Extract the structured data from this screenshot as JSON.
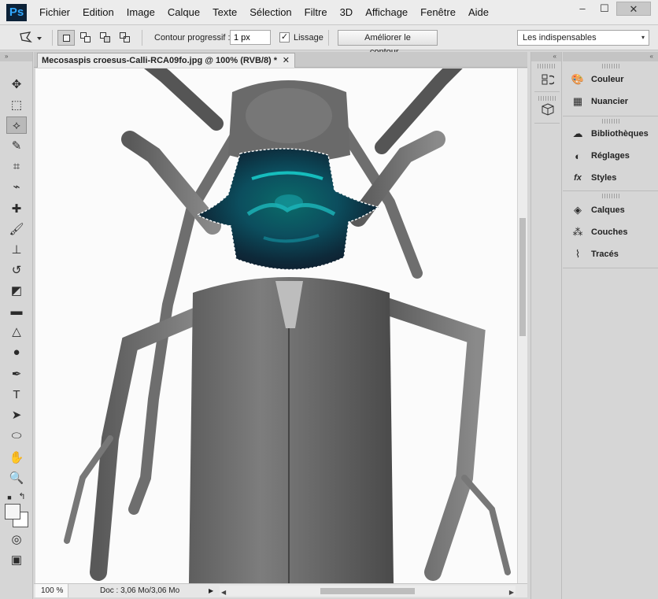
{
  "app": {
    "logo_text": "Ps"
  },
  "menu": {
    "items": [
      "Fichier",
      "Edition",
      "Image",
      "Calque",
      "Texte",
      "Sélection",
      "Filtre",
      "3D",
      "Affichage",
      "Fenêtre",
      "Aide"
    ]
  },
  "window_controls": {
    "minimize": "–",
    "maximize": "☐",
    "close": "✕"
  },
  "options_bar": {
    "feather_label": "Contour progressif :",
    "feather_value": "1 px",
    "antialias_label": "Lissage",
    "antialias_checked": "✓",
    "refine_edge_label": "Améliorer le contour...",
    "workspace_value": "Les indispensables",
    "chevron": "▾"
  },
  "tools": {
    "header": "»",
    "list": [
      {
        "name": "move-tool-icon",
        "glyph": "✥"
      },
      {
        "name": "marquee-tool-icon",
        "glyph": "⬚"
      },
      {
        "name": "polygonal-lasso-tool-icon",
        "glyph": "⟡"
      },
      {
        "name": "quick-selection-tool-icon",
        "glyph": "✎"
      },
      {
        "name": "crop-tool-icon",
        "glyph": "⌗"
      },
      {
        "name": "eyedropper-tool-icon",
        "glyph": "⌁"
      },
      {
        "name": "healing-brush-tool-icon",
        "glyph": "✚"
      },
      {
        "name": "brush-tool-icon",
        "glyph": "🖌"
      },
      {
        "name": "clone-stamp-tool-icon",
        "glyph": "⊥"
      },
      {
        "name": "history-brush-tool-icon",
        "glyph": "↺"
      },
      {
        "name": "eraser-tool-icon",
        "glyph": "◩"
      },
      {
        "name": "gradient-tool-icon",
        "glyph": "▬"
      },
      {
        "name": "blur-tool-icon",
        "glyph": "△"
      },
      {
        "name": "dodge-tool-icon",
        "glyph": "●"
      },
      {
        "name": "pen-tool-icon",
        "glyph": "✒"
      },
      {
        "name": "type-tool-icon",
        "glyph": "T"
      },
      {
        "name": "path-selection-tool-icon",
        "glyph": "➤"
      },
      {
        "name": "ellipse-tool-icon",
        "glyph": "⬭"
      },
      {
        "name": "hand-tool-icon",
        "glyph": "✋"
      },
      {
        "name": "zoom-tool-icon",
        "glyph": "🔍"
      }
    ],
    "swap_colors": "↰",
    "quick_mask": "◎",
    "screen_mode": "▣"
  },
  "document": {
    "tab_title": "Mecosaspis croesus-Calli-RCA09fo.jpg @ 100% (RVB/8) *",
    "tab_close": "✕"
  },
  "status_bar": {
    "zoom": "100 %",
    "doc_info": "Doc : 3,06 Mo/3,06 Mo",
    "arrow": "▶",
    "scroll_left": "◀",
    "scroll_right": "▶"
  },
  "dock_strip": {
    "header": "«",
    "icons": [
      "history-icon",
      "3d-panel-icon"
    ]
  },
  "panels": {
    "header": "«",
    "groups": [
      {
        "items": [
          {
            "label": "Couleur",
            "icon": "palette-icon",
            "glyph": "🎨"
          },
          {
            "label": "Nuancier",
            "icon": "swatches-grid-icon",
            "glyph": "▦"
          }
        ]
      },
      {
        "items": [
          {
            "label": "Bibliothèques",
            "icon": "libraries-icon",
            "glyph": "☁"
          },
          {
            "label": "Réglages",
            "icon": "adjustments-icon",
            "glyph": "◐"
          },
          {
            "label": "Styles",
            "icon": "styles-icon",
            "glyph": "fx"
          }
        ]
      },
      {
        "items": [
          {
            "label": "Calques",
            "icon": "layers-icon",
            "glyph": "◈"
          },
          {
            "label": "Couches",
            "icon": "channels-icon",
            "glyph": "⁂"
          },
          {
            "label": "Tracés",
            "icon": "paths-icon",
            "glyph": "⌇"
          }
        ]
      }
    ]
  },
  "colors": {
    "accent_selection": "#19d8d4",
    "brand_bg": "#0c2238",
    "brand_fg": "#31a8ff"
  }
}
